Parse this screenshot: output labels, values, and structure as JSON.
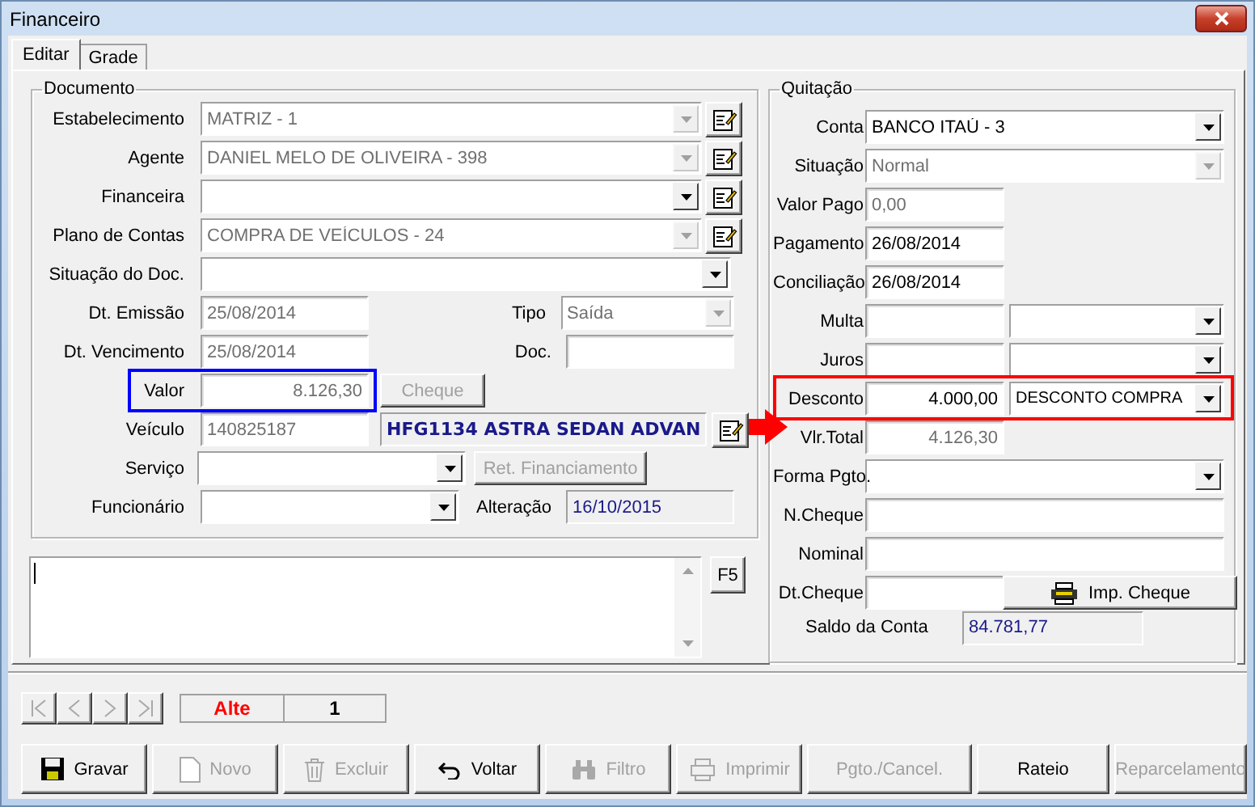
{
  "window": {
    "title": "Financeiro"
  },
  "tabs": [
    {
      "label": "Editar",
      "selected": true
    },
    {
      "label": "Grade",
      "selected": false
    }
  ],
  "documento": {
    "title": "Documento",
    "rows": [
      {
        "label": "Estabelecimento",
        "field": {
          "kind": "combo",
          "value": "MATRIZ - 1",
          "disabled": true
        },
        "edit_button": true
      },
      {
        "label": "Agente",
        "field": {
          "kind": "combo",
          "value": "DANIEL MELO DE OLIVEIRA - 398",
          "disabled": true
        },
        "edit_button": true
      },
      {
        "label": "Financeira",
        "field": {
          "kind": "combo",
          "disabled": false
        },
        "edit_button": true
      },
      {
        "label": "Plano de Contas",
        "field": {
          "kind": "combo",
          "value": "COMPRA DE VEÍCULOS - 24",
          "disabled": true
        },
        "edit_button": true
      },
      {
        "label": "Situação do Doc.",
        "field": {
          "kind": "combo",
          "disabled": false
        },
        "edit_button": false
      },
      {
        "label": "Dt. Emissão",
        "field": {
          "kind": "text",
          "value": "25/08/2014",
          "disabled": true
        },
        "side": {
          "kind": "labeled",
          "label": "Tipo",
          "field": {
            "kind": "combo",
            "value": "Saída",
            "disabled": true
          }
        }
      },
      {
        "label": "Dt. Vencimento",
        "field": {
          "kind": "text",
          "value": "25/08/2014",
          "disabled": true
        },
        "side": {
          "kind": "labeled",
          "label": "Doc.",
          "field": {
            "kind": "text"
          }
        }
      },
      {
        "label": "Valor",
        "highlighted": true,
        "field": {
          "kind": "number",
          "value": "8.126,30",
          "disabled": true
        },
        "side": {
          "kind": "button",
          "label": "Cheque",
          "disabled": true
        }
      },
      {
        "label": "Veículo",
        "field": {
          "kind": "text",
          "value": "140825187",
          "disabled": true
        },
        "side": {
          "kind": "plate",
          "value": "HFG1134 ASTRA SEDAN ADVAN"
        }
      },
      {
        "label": "Serviço",
        "field": {
          "kind": "combo",
          "disabled": false
        },
        "side": {
          "kind": "button",
          "label": "Ret. Financiamento",
          "disabled": true
        }
      },
      {
        "label": "Funcionário",
        "field": {
          "kind": "combo",
          "disabled": false
        },
        "side": {
          "kind": "labeled",
          "label": "Alteração",
          "field": {
            "kind": "display",
            "value": "16/10/2015"
          }
        }
      }
    ]
  },
  "memo": {
    "refresh_button": "F5"
  },
  "quitacao": {
    "title": "Quitação",
    "rows": [
      {
        "label": "Conta",
        "field": {
          "kind": "combo",
          "value": "BANCO ITAÚ - 3",
          "disabled": false
        }
      },
      {
        "label": "Situação",
        "field": {
          "kind": "combo",
          "value": "Normal",
          "disabled": true
        }
      },
      {
        "label": "Valor Pago",
        "field": {
          "kind": "text",
          "value": "0,00",
          "disabled": true
        }
      },
      {
        "label": "Pagamento",
        "field": {
          "kind": "text",
          "value": "26/08/2014",
          "disabled": false
        }
      },
      {
        "label": "Conciliação",
        "field": {
          "kind": "text",
          "value": "26/08/2014",
          "disabled": false
        }
      },
      {
        "label": "Multa",
        "field": {
          "kind": "text"
        },
        "side": {
          "kind": "combo",
          "disabled": false
        }
      },
      {
        "label": "Juros",
        "field": {
          "kind": "text"
        },
        "side": {
          "kind": "combo",
          "disabled": false
        }
      },
      {
        "label": "Desconto",
        "highlighted": true,
        "field": {
          "kind": "number",
          "value": "4.000,00",
          "disabled": false
        },
        "side": {
          "kind": "combo",
          "value": "DESCONTO COMPRA",
          "disabled": false
        }
      },
      {
        "label": "Vlr.Total",
        "field": {
          "kind": "number",
          "value": "4.126,30",
          "disabled": true
        }
      },
      {
        "label": "Forma Pgto.",
        "field": {
          "kind": "combo",
          "disabled": false
        }
      },
      {
        "label": "N.Cheque",
        "field": {
          "kind": "wide"
        }
      },
      {
        "label": "Nominal",
        "field": {
          "kind": "wide"
        }
      },
      {
        "label": "Dt.Cheque",
        "field": {
          "kind": "text"
        },
        "side": {
          "kind": "button",
          "label": "Imp. Cheque",
          "disabled": false
        }
      }
    ],
    "saldo": {
      "label": "Saldo da Conta",
      "value": "84.781,77"
    }
  },
  "navigator": [
    {
      "disabled": true
    },
    {
      "disabled": true
    },
    {
      "disabled": true
    },
    {
      "disabled": true
    }
  ],
  "record": {
    "mode": "Alte",
    "number": "1"
  },
  "toolbar": [
    {
      "label": "Gravar",
      "disabled": false
    },
    {
      "label": "Novo",
      "disabled": true
    },
    {
      "label": "Excluir",
      "disabled": true
    },
    {
      "label": "Voltar",
      "disabled": false
    },
    {
      "label": "Filtro",
      "disabled": true
    },
    {
      "label": "Imprimir",
      "disabled": true
    },
    {
      "label": "Pgto./Cancel.",
      "disabled": true
    },
    {
      "label": "Rateio",
      "disabled": false
    },
    {
      "label": "Reparcelamento",
      "disabled": true
    }
  ]
}
